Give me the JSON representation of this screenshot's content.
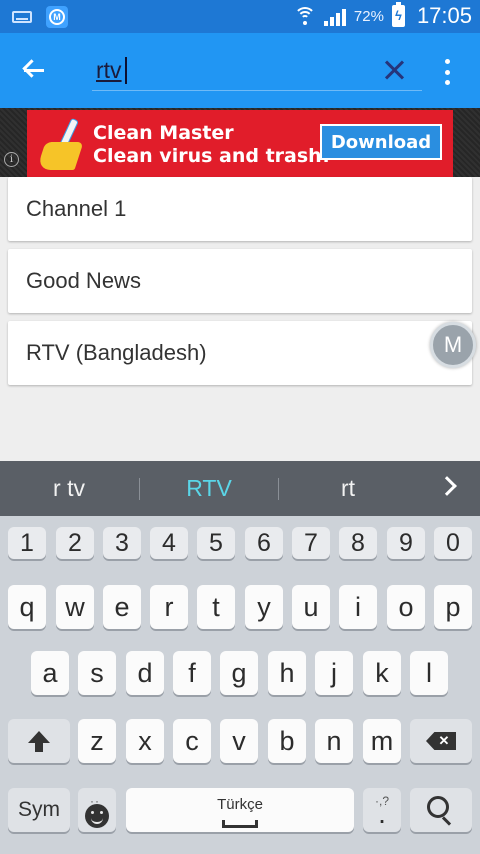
{
  "status_bar": {
    "battery_percent": "72%",
    "time": "17:05",
    "badge_letter": "M"
  },
  "app_bar": {
    "search_query": "rtv"
  },
  "ad": {
    "line1": "Clean Master",
    "line2": "Clean virus and trash!",
    "button_label": "Download",
    "info_glyph": "i"
  },
  "results": [
    {
      "label": "Channel 1"
    },
    {
      "label": "Good News"
    },
    {
      "label": "RTV (Bangladesh)"
    }
  ],
  "floating_button": {
    "letter": "M"
  },
  "keyboard": {
    "suggestions": [
      "r tv",
      "RTV",
      "rt"
    ],
    "number_row": [
      "1",
      "2",
      "3",
      "4",
      "5",
      "6",
      "7",
      "8",
      "9",
      "0"
    ],
    "row1": [
      "q",
      "w",
      "e",
      "r",
      "t",
      "y",
      "u",
      "i",
      "o",
      "p"
    ],
    "row2": [
      "a",
      "s",
      "d",
      "f",
      "g",
      "h",
      "j",
      "k",
      "l"
    ],
    "row3": [
      "z",
      "x",
      "c",
      "v",
      "b",
      "n",
      "m"
    ],
    "sym_label": "Sym",
    "space_language": "Türkçe",
    "period_label": ".",
    "period_extra": "·,?",
    "mic_dots": "··"
  }
}
